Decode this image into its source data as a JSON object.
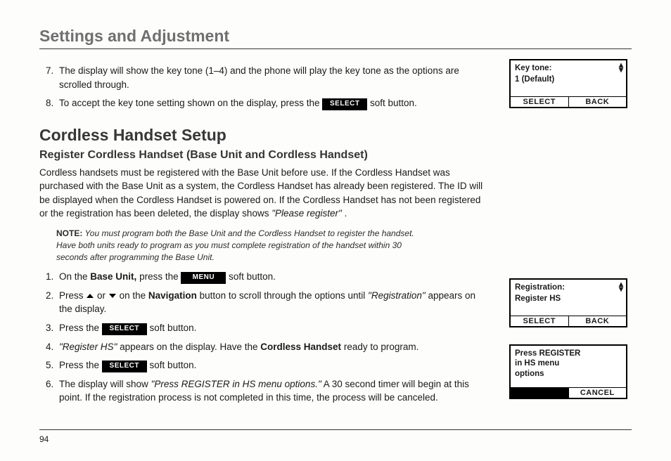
{
  "page": {
    "title": "Settings and Adjustment",
    "number": "94"
  },
  "top_list": {
    "start": 7,
    "items": [
      {
        "pre": "The display will show the key tone (1–4) and the phone will play the key tone as the options are scrolled through."
      },
      {
        "pre": "To accept the key tone setting shown on the display, press the ",
        "chip": "SELECT",
        "post": " soft button."
      }
    ]
  },
  "section": {
    "title": "Cordless Handset Setup",
    "subtitle": "Register Cordless Handset (Base Unit and Cordless Handset)",
    "intro_parts": {
      "p1": "Cordless handsets must be registered with the Base Unit before use. If the Cordless Handset was purchased with the Base Unit as a system, the Cordless Handset has already been registered. The ID will be displayed when the Cordless Handset is powered on. If the Cordless Handset has not been registered or the registration has been deleted, the display shows ",
      "italic": "\"Please register\"",
      "p2": "."
    },
    "note": {
      "label": "NOTE:",
      "text": " You must program both the Base Unit and the Cordless Handset to register the handset. Have both units ready to program as you must complete registration of the handset within 30 seconds after programming the Base Unit."
    },
    "steps": {
      "s1_pre": "On the ",
      "s1_bold": "Base Unit,",
      "s1_mid": " press the ",
      "s1_chip": "MENU",
      "s1_post": " soft button.",
      "s2_pre": "Press ",
      "s2_mid": " or ",
      "s2_after_arrows": " on the ",
      "s2_bold": "Navigation",
      "s2_more": " button to scroll through the options until ",
      "s2_italic": "\"Registration\"",
      "s2_post": " appears on the display.",
      "s3_pre": "Press the ",
      "s3_chip": "SELECT",
      "s3_post": " soft button.",
      "s4_italic": "\"Register HS\"",
      "s4_mid": " appears on the display. Have the ",
      "s4_bold": "Cordless Handset",
      "s4_post": " ready to program.",
      "s5_pre": "Press the ",
      "s5_chip": "SELECT",
      "s5_post": " soft button.",
      "s6_pre": "The display will show ",
      "s6_italic": "\"Press REGISTER in HS menu options.\"",
      "s6_post": " A 30 second timer will begin at this point. If the registration process is not completed in this time, the process will be canceled."
    }
  },
  "screens": {
    "s1": {
      "line1": "Key tone:",
      "line2": "1 (Default)",
      "left": "SELECT",
      "right": "BACK"
    },
    "s2": {
      "line1": "Registration:",
      "line2": "Register HS",
      "left": "SELECT",
      "right": "BACK"
    },
    "s3": {
      "line1": "Press REGISTER",
      "line2": "in HS menu",
      "line3": "options",
      "left": "",
      "right": "CANCEL"
    }
  }
}
